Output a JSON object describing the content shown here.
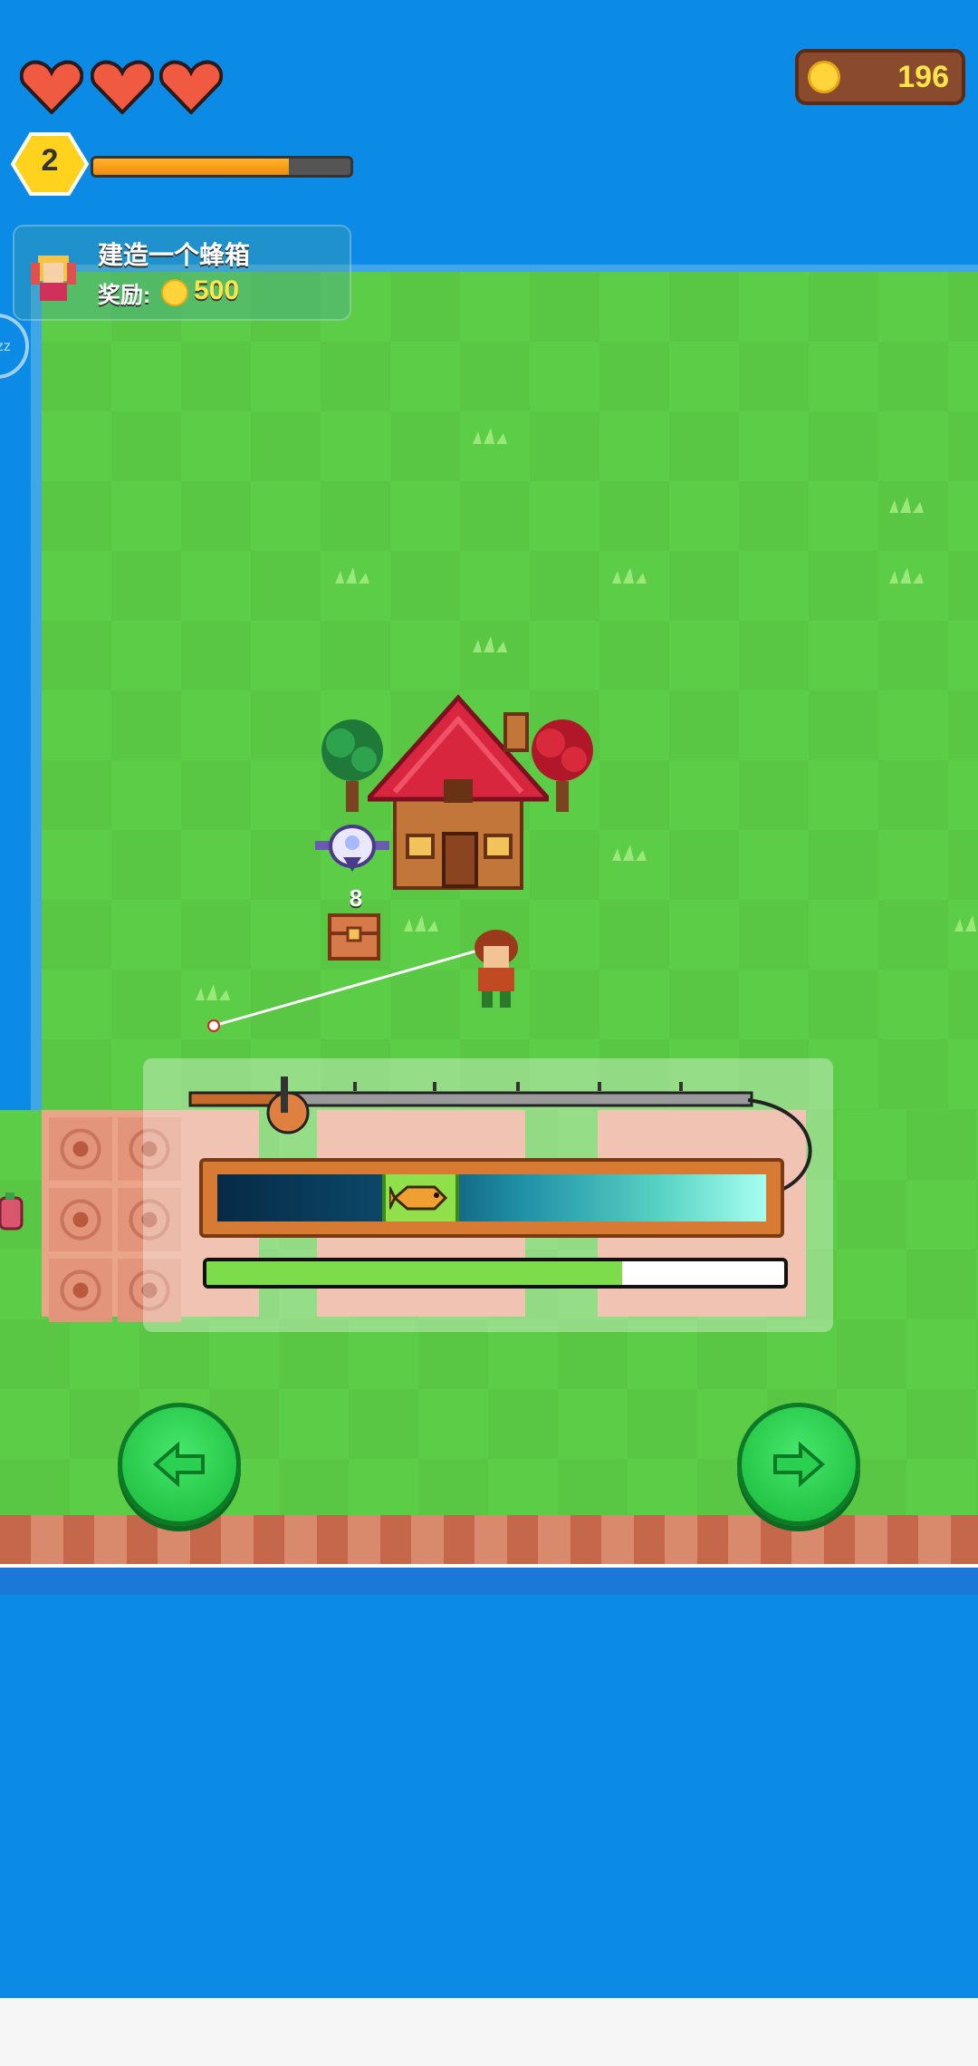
{
  "hud": {
    "hearts": 3,
    "coins": "196",
    "level": "2",
    "xp_progress": 0.76
  },
  "quest": {
    "title": "建造一个蜂箱",
    "reward_label": "奖励:",
    "reward_value": "500"
  },
  "world": {
    "chest_count": "8"
  },
  "fishing": {
    "catch_zone_start": 0.3,
    "catch_zone_end": 0.44,
    "catch_progress": 0.72
  },
  "colors": {
    "water": "#0b8ae6",
    "grass": "#5ccd47",
    "button_green": "#17b83a",
    "coin_gold": "#ffd43b"
  },
  "icons": [
    "heart-icon",
    "coin-icon",
    "level-hexagon-icon",
    "fish-icon",
    "left-arrow-icon",
    "right-arrow-icon",
    "house-icon",
    "tree-icon",
    "chest-icon",
    "drone-icon",
    "player-character",
    "fishing-rod-icon"
  ]
}
